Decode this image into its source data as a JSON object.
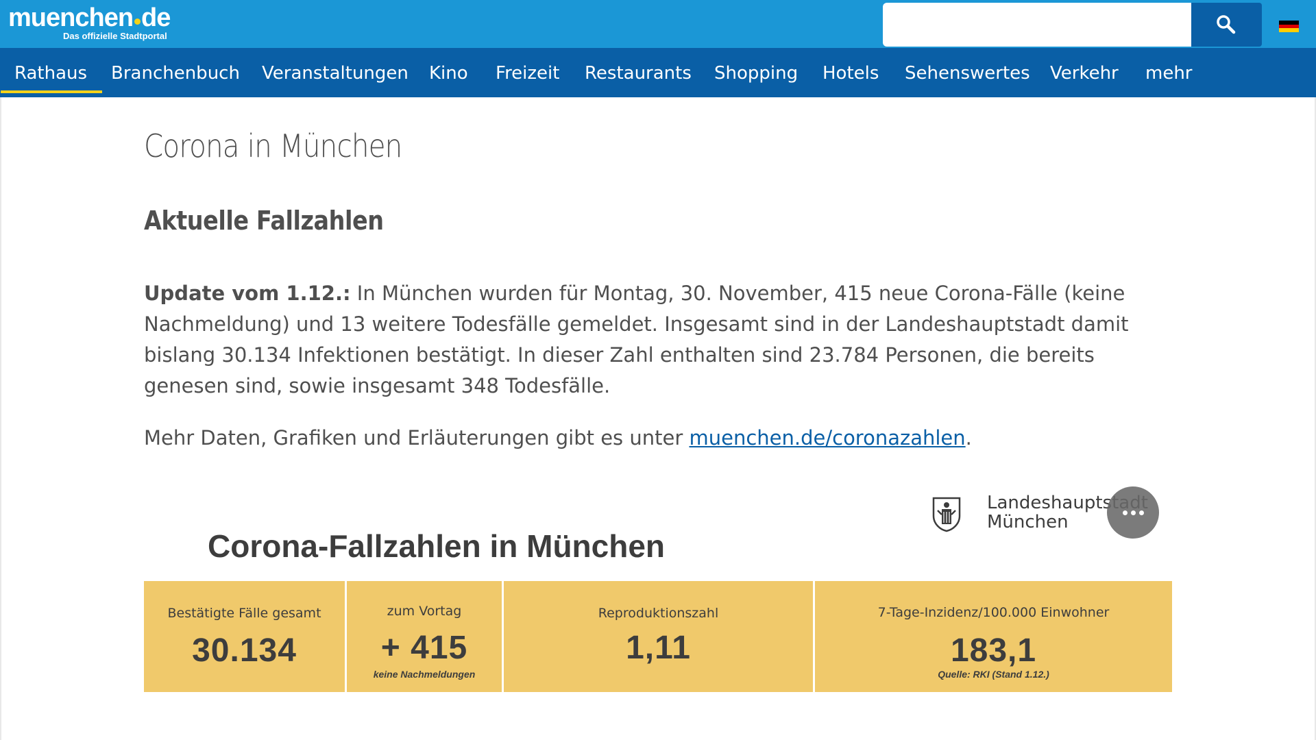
{
  "header": {
    "logo_main_a": "muenchen",
    "logo_main_b": "de",
    "logo_sub": "Das offizielle Stadtportal",
    "search_value": "",
    "search_icon": "search-icon",
    "language_flag": "germany-flag-icon"
  },
  "nav": {
    "items": [
      {
        "label": "Rathaus",
        "active": true
      },
      {
        "label": "Branchenbuch"
      },
      {
        "label": "Veranstaltungen"
      },
      {
        "label": "Kino"
      },
      {
        "label": "Freizeit"
      },
      {
        "label": "Restaurants"
      },
      {
        "label": "Shopping"
      },
      {
        "label": "Hotels"
      },
      {
        "label": "Sehenswertes"
      },
      {
        "label": "Verkehr"
      },
      {
        "label": "mehr"
      }
    ]
  },
  "article": {
    "title": "Corona in München",
    "section_title": "Aktuelle Fallzahlen",
    "update_prefix": "Update vom 1.12.:",
    "update_text": " In München wurden für Montag, 30. November, 415 neue Corona-Fälle (keine Nachmeldung) und 13 weitere Todesfälle gemeldet. Insgesamt sind in der Landeshauptstadt damit bislang 30.134 Infektionen bestätigt. In dieser Zahl enthalten sind 23.784 Personen, die bereits genesen sind, sowie insgesamt 348 Todesfälle.",
    "more_text": "Mehr Daten, Grafiken und Erläuterungen gibt es unter ",
    "more_link": "muenchen.de/coronazahlen",
    "more_suffix": "."
  },
  "widget": {
    "city_line1": "Landeshauptstadt",
    "city_line2": "München",
    "title": "Corona-Fallzahlen in München",
    "stats": [
      {
        "label": "Bestätigte Fälle gesamt",
        "value": "30.134",
        "note": ""
      },
      {
        "label": "zum Vortag",
        "value": "+ 415",
        "note": "keine Nachmeldungen"
      },
      {
        "label": "Reproduktionszahl",
        "value": "1,11",
        "note": ""
      },
      {
        "label": "7-Tage-Inzidenz/100.000 Einwohner",
        "value": "183,1",
        "note": "Quelle: RKI (Stand 1.12.)"
      }
    ]
  },
  "colors": {
    "topbar": "#1b97d6",
    "navbar": "#0a5fa6",
    "active_underline": "#f5d21a",
    "stat_background": "#f0c96b",
    "link": "#0a5fa6"
  }
}
